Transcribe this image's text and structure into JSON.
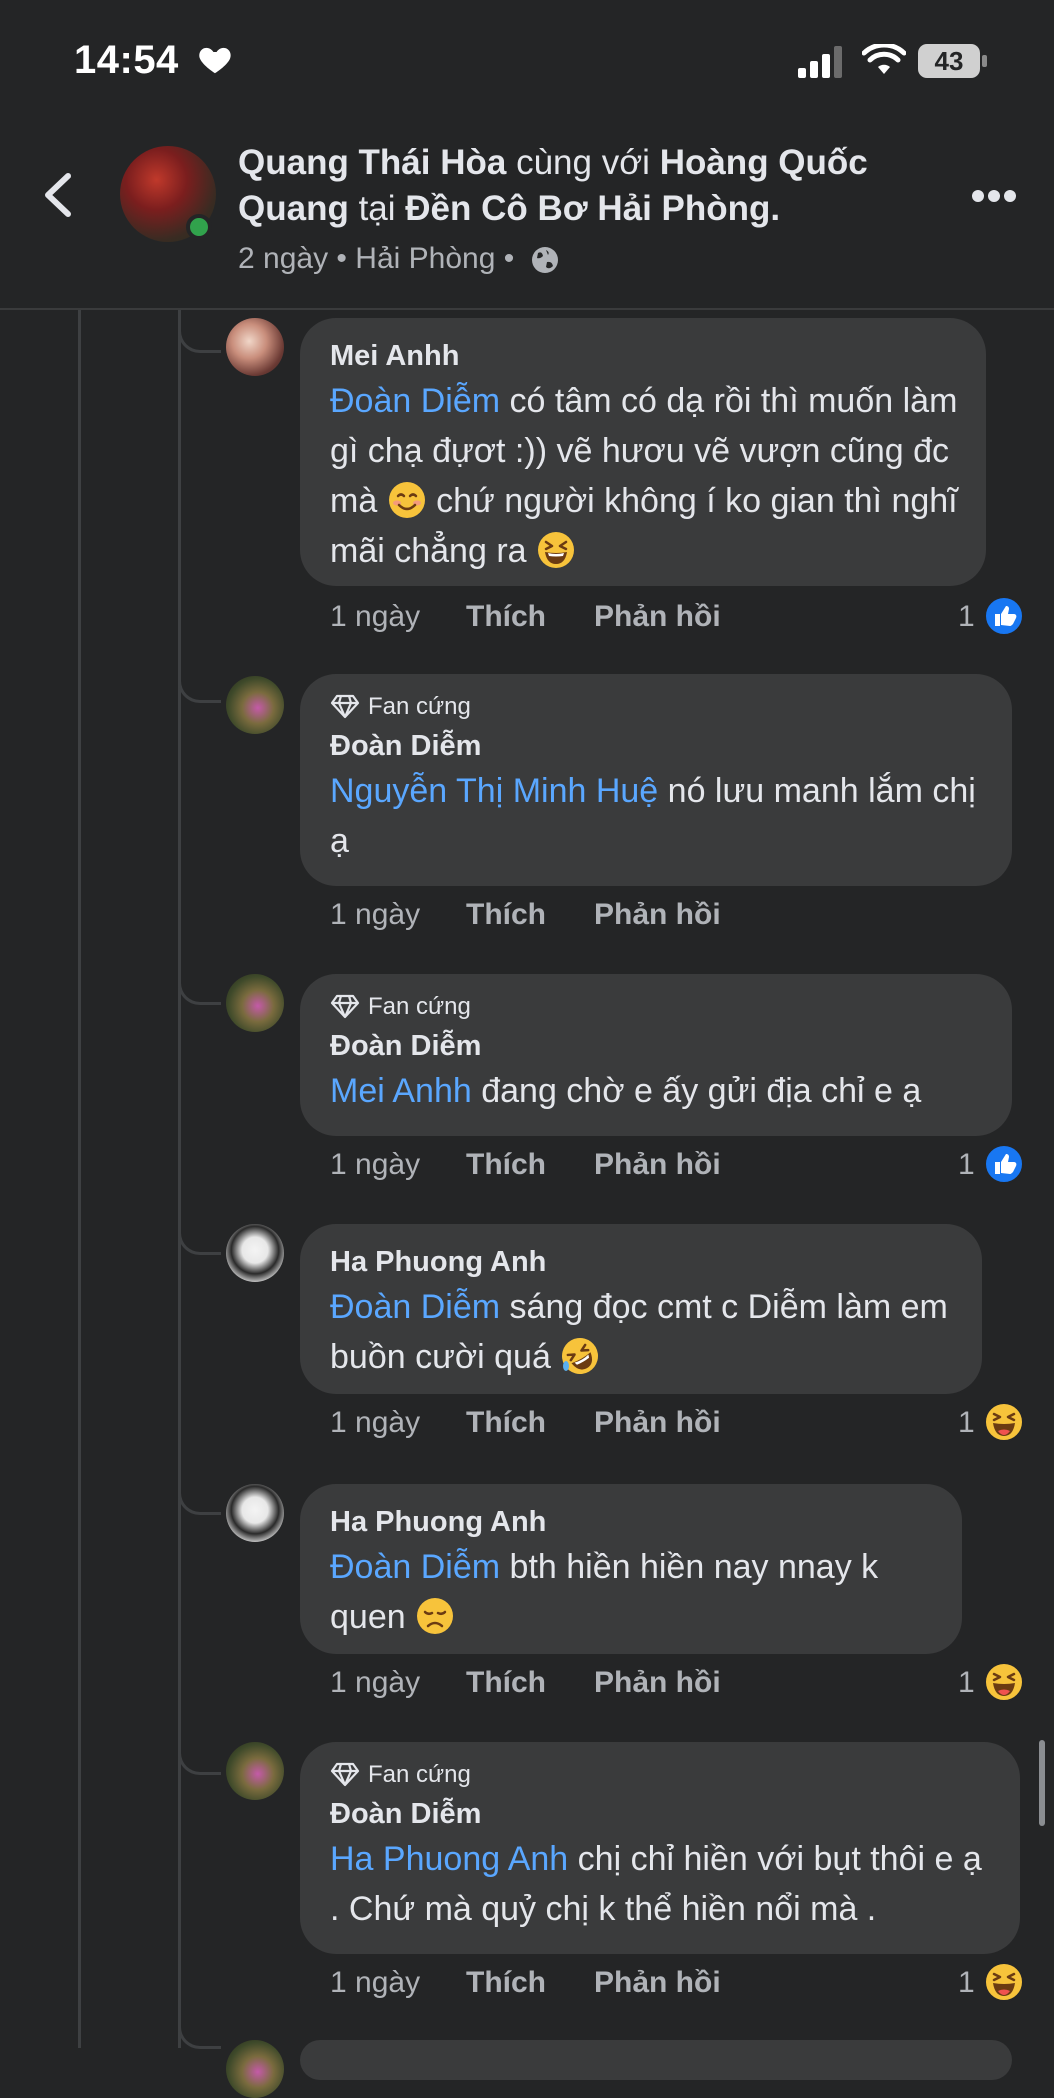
{
  "status_bar": {
    "time": "14:54",
    "battery": "43"
  },
  "header": {
    "author": "Quang Thái Hòa",
    "with_word": "cùng với",
    "tagged": "Hoàng Quốc Quang",
    "at_word": "tại",
    "place": "Đền Cô Bơ Hải Phòng.",
    "time_ago": "2 ngày",
    "location": "Hải Phòng",
    "separator": "•"
  },
  "labels": {
    "like": "Thích",
    "reply": "Phản hồi",
    "fan_badge": "Fan cứng"
  },
  "comments": [
    {
      "author": "Mei Anhh",
      "badge": "",
      "mention": "Đoàn Diễm",
      "text_1": "có tâm có dạ rồi thì muốn làm gì chạ đựơt :)) vẽ hươu vẽ vượn cũng đc mà",
      "text_2": "chứ người không í ko gian thì nghĩ mãi chẳng ra",
      "emoji_1": "smiling-face",
      "emoji_2": "grinning-squinting-face",
      "time": "1 ngày",
      "reactions": "1",
      "reaction_icon": "like"
    },
    {
      "author": "Đoàn Diễm",
      "badge": "Fan cứng",
      "mention": "Nguyễn Thị Minh Huệ",
      "text_1": "nó lưu manh lắm chị ạ",
      "time": "1 ngày",
      "reactions": ""
    },
    {
      "author": "Đoàn Diễm",
      "badge": "Fan cứng",
      "mention": "Mei Anhh",
      "text_1": "đang chờ e ấy gửi địa chỉ e ạ",
      "time": "1 ngày",
      "reactions": "1",
      "reaction_icon": "like"
    },
    {
      "author": "Ha Phuong Anh",
      "badge": "",
      "mention": "Đoàn Diễm",
      "text_1": "sáng đọc cmt c Diễm làm em buồn cười quá",
      "emoji_1": "rolling-on-floor-laughing",
      "time": "1 ngày",
      "reactions": "1",
      "reaction_icon": "haha"
    },
    {
      "author": "Ha Phuong Anh",
      "badge": "",
      "mention": "Đoàn Diễm",
      "text_1": "bth hiền hiền nay nnay k quen",
      "emoji_1": "disappointed-face",
      "time": "1 ngày",
      "reactions": "1",
      "reaction_icon": "haha"
    },
    {
      "author": "Đoàn Diễm",
      "badge": "Fan cứng",
      "mention": "Ha Phuong Anh",
      "text_1": "chị chỉ hiền với bụt thôi e ạ . Chứ mà quỷ chị k thể hiền nổi mà .",
      "time": "1 ngày",
      "reactions": "1",
      "reaction_icon": "haha"
    }
  ],
  "colors": {
    "background": "#242526",
    "bubble": "#3a3b3c",
    "mention": "#5aa7ff",
    "like_blue": "#1877f2",
    "online_green": "#31a24c",
    "text": "#e4e6eb",
    "muted": "#b0b3b8"
  }
}
